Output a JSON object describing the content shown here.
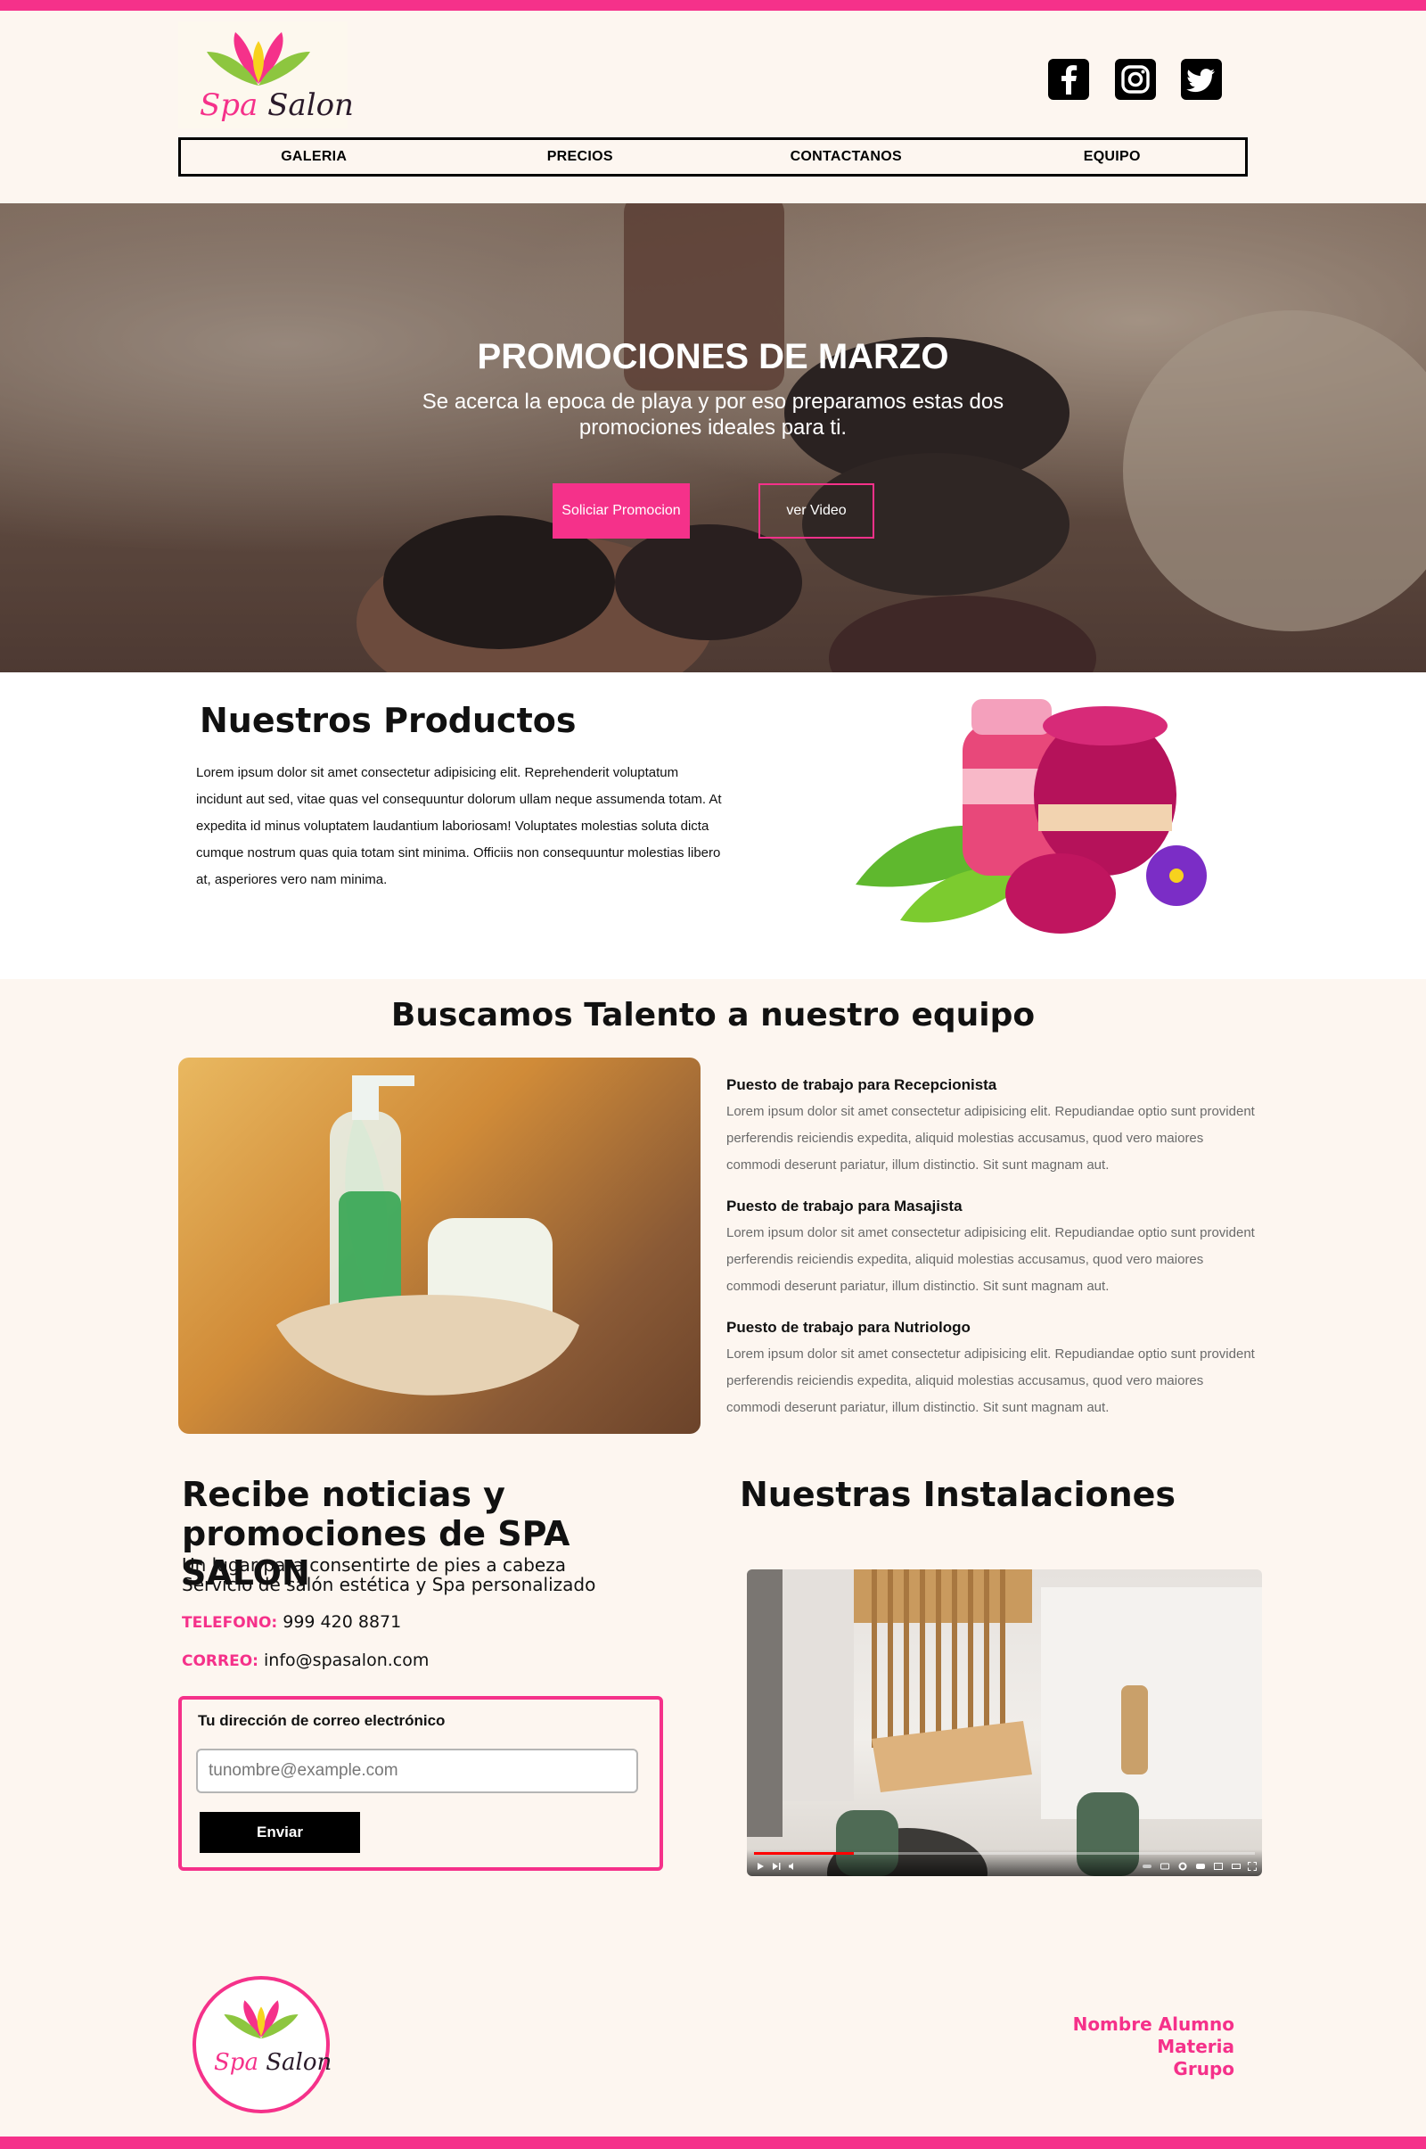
{
  "brand": {
    "logo_text_a": "Spa",
    "logo_text_b": "Salon",
    "accent": "#f5318a"
  },
  "social": [
    {
      "name": "facebook-icon"
    },
    {
      "name": "instagram-icon"
    },
    {
      "name": "twitter-icon"
    }
  ],
  "nav": {
    "items": [
      "GALERIA",
      "PRECIOS",
      "CONTACTANOS",
      "EQUIPO"
    ]
  },
  "hero": {
    "title": "PROMOCIONES DE MARZO",
    "subtitle": "Se acerca la epoca de playa y por eso preparamos estas dos promociones ideales para ti.",
    "primary_button": "Soliciar Promocion",
    "secondary_button": "ver Video"
  },
  "products": {
    "title": "Nuestros Productos",
    "body": "Lorem ipsum dolor sit amet consectetur adipisicing elit. Reprehenderit voluptatum incidunt aut sed, vitae quas vel consequuntur dolorum ullam neque assumenda totam. At expedita id minus voluptatem laudantium laboriosam! Voluptates molestias soluta dicta cumque nostrum quas quia totam sint minima. Officiis non consequuntur molestias libero at, asperiores vero nam minima."
  },
  "talent": {
    "title": "Buscamos Talento a nuestro equipo",
    "jobs": [
      {
        "title": "Puesto de trabajo para Recepcionista",
        "desc": "Lorem ipsum dolor sit amet consectetur adipisicing elit. Repudiandae optio sunt provident perferendis reiciendis expedita, aliquid molestias accusamus, quod vero maiores commodi deserunt pariatur, illum distinctio. Sit sunt magnam aut."
      },
      {
        "title": "Puesto de trabajo para Masajista",
        "desc": "Lorem ipsum dolor sit amet consectetur adipisicing elit. Repudiandae optio sunt provident perferendis reiciendis expedita, aliquid molestias accusamus, quod vero maiores commodi deserunt pariatur, illum distinctio. Sit sunt magnam aut."
      },
      {
        "title": "Puesto de trabajo para Nutriologo",
        "desc": "Lorem ipsum dolor sit amet consectetur adipisicing elit. Repudiandae optio sunt provident perferendis reiciendis expedita, aliquid molestias accusamus, quod vero maiores commodi deserunt pariatur, illum distinctio. Sit sunt magnam aut."
      }
    ]
  },
  "newsletter": {
    "title": "Recibe noticias y promociones de SPA SALON",
    "line1": "Un lugar para consentirte de pies a cabeza",
    "line2": "Servicio de salón estética y Spa personalizado",
    "phone_label": "TELEFONO:",
    "phone": "999 420 8871",
    "email_label": "CORREO:",
    "email": "info@spasalon.com",
    "form_label": "Tu dirección de correo electrónico",
    "input_placeholder": "tunombre@example.com",
    "submit": "Enviar"
  },
  "installations": {
    "title": "Nuestras Instalaciones",
    "video_progress": 0.2
  },
  "footer": {
    "logo_text_a": "Spa",
    "logo_text_b": "Salon",
    "name": "Nombre Alumno",
    "subject": "Materia",
    "group": "Grupo"
  }
}
